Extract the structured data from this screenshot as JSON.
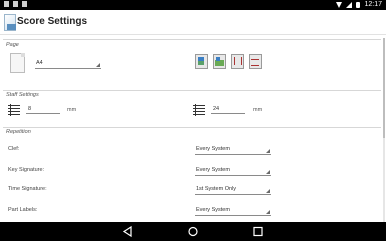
{
  "status_bar": {
    "time": "12:17"
  },
  "app_bar": {
    "title": "Score Settings"
  },
  "page_section": {
    "label": "Page",
    "paper_size": "A4"
  },
  "staff_section": {
    "label": "Staff Settings",
    "staff_height_value": "8",
    "staff_height_unit": "mm",
    "staff_spacing_value": "24",
    "staff_spacing_unit": "mm"
  },
  "repetition_section": {
    "label": "Repetition",
    "rows": [
      {
        "label": "Clef:",
        "value": "Every System"
      },
      {
        "label": "Key Signature:",
        "value": "Every System"
      },
      {
        "label": "Time Signature:",
        "value": "1st System Only"
      },
      {
        "label": "Part Labels:",
        "value": "Every System"
      }
    ]
  },
  "nav_bar": {
    "back": "back-icon",
    "home": "home-icon",
    "recents": "recents-icon"
  }
}
